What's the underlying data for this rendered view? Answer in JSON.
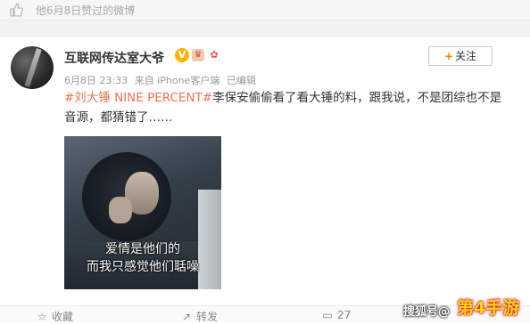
{
  "top": {
    "liked_text": "他6月8日赞过的微博"
  },
  "post": {
    "username": "互联网传达室大爷",
    "badges": {
      "vip": "V"
    },
    "follow_label": "关注",
    "meta": {
      "date": "6月8日 23:33",
      "source": "来自 iPhone客户端",
      "edited": "已编辑"
    },
    "text": {
      "hashtag": "#刘大锤 NINE PERCENT#",
      "body": "李保安偷偷看了看大锤的料，跟我说，不是团综也不是音源，都猜错了……"
    },
    "image": {
      "caption_line1": "爱情是他们的",
      "caption_line2": "而我只感觉他们聒噪"
    }
  },
  "actions": {
    "collect": "收藏",
    "repost": "转发",
    "comment": "27"
  },
  "watermarks": {
    "sohu": "搜狐号@",
    "game": "第4手游"
  },
  "colors": {
    "accent": "#ff8200",
    "hashtag": "#eb7350",
    "meta": "#999999"
  }
}
